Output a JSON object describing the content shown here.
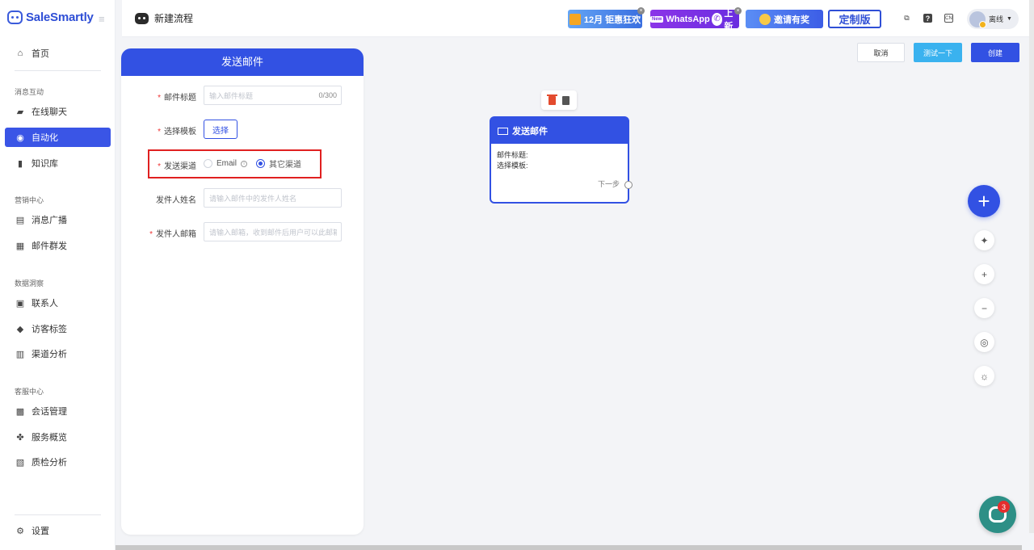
{
  "brand": {
    "name": "SaleSmartly"
  },
  "sidebar": {
    "home": "首页",
    "sections": {
      "messaging": "消息互动",
      "marketing": "营销中心",
      "insights": "数据洞察",
      "service": "客服中心"
    },
    "items": {
      "live_chat": "在线聊天",
      "automation": "自动化",
      "knowledge": "知识库",
      "broadcast": "消息广播",
      "email_mass": "邮件群发",
      "contacts": "联系人",
      "visitor_tags": "访客标签",
      "channel_analysis": "渠道分析",
      "conversation_mgmt": "会话管理",
      "service_overview": "服务概览",
      "qa_analysis": "质检分析",
      "settings": "设置"
    }
  },
  "header": {
    "title": "新建流程",
    "banners": {
      "december_a": "12月",
      "december_b": "钜惠狂欢",
      "whatsapp_new": "New",
      "whatsapp": "WhatsApp",
      "whatsapp_launch": "上新",
      "invite": "邀请有奖",
      "custom": "定制版"
    },
    "help_icon_text": "?",
    "lang_icon_text": "CN",
    "user_status": "离线"
  },
  "form": {
    "title": "发送邮件",
    "email_subject_label": "邮件标题",
    "email_subject_placeholder": "输入邮件标题",
    "email_subject_count": "0/300",
    "template_label": "选择模板",
    "template_button": "选择",
    "channel_label": "发送渠道",
    "channel_options": [
      "Email",
      "其它渠道"
    ],
    "channel_selected": "其它渠道",
    "sender_name_label": "发件人姓名",
    "sender_name_placeholder": "请输入邮件中的发件人姓名",
    "sender_email_label": "发件人邮箱",
    "sender_email_placeholder": "请输入邮箱，收到邮件后用户可以此邮箱"
  },
  "toolbar": {
    "cancel": "取消",
    "test": "测试一下",
    "create": "创建"
  },
  "node": {
    "title": "发送邮件",
    "subject_label": "邮件标题:",
    "template_label": "选择模板:",
    "next": "下一步"
  },
  "chat_badge": "3",
  "colors": {
    "primary": "#3251e3",
    "test_button": "#3ab2ef",
    "highlight": "#e02020",
    "chat": "#2d8f86"
  }
}
